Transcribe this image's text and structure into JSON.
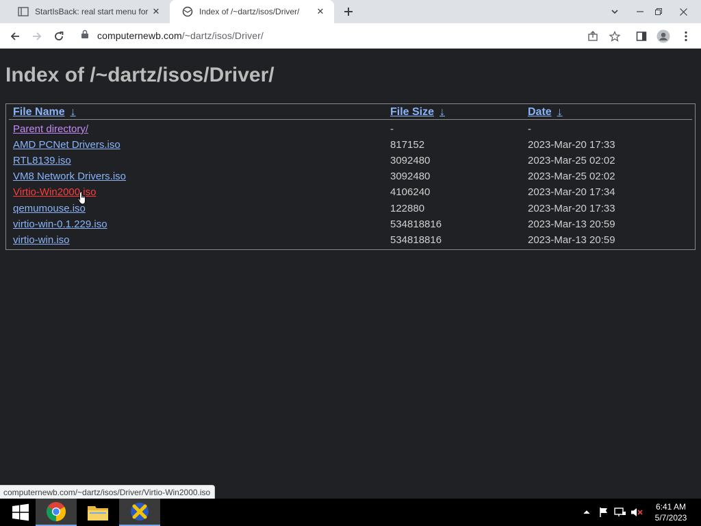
{
  "browser": {
    "tabs": [
      {
        "title": "StartIsBack: real start menu for W",
        "close": "✕",
        "active": false
      },
      {
        "title": "Index of /~dartz/isos/Driver/",
        "close": "✕",
        "active": true
      }
    ],
    "url_host": "computernewb.com",
    "url_path": "/~dartz/isos/Driver/",
    "status_url": "computernewb.com/~dartz/isos/Driver/Virtio-Win2000.iso"
  },
  "page": {
    "title": "Index of /~dartz/isos/Driver/",
    "columns": {
      "name": "File Name",
      "size": "File Size",
      "date": "Date",
      "sort_arrow": "↓"
    },
    "rows": [
      {
        "name": "Parent directory/",
        "size": "-",
        "date": "-",
        "state": "visited"
      },
      {
        "name": "AMD PCNet Drivers.iso",
        "size": "817152",
        "date": "2023-Mar-20 17:33",
        "state": "link"
      },
      {
        "name": "RTL8139.iso",
        "size": "3092480",
        "date": "2023-Mar-25 02:02",
        "state": "link"
      },
      {
        "name": "VM8 Network Drivers.iso",
        "size": "3092480",
        "date": "2023-Mar-25 02:02",
        "state": "link"
      },
      {
        "name": "Virtio-Win2000.iso",
        "size": "4106240",
        "date": "2023-Mar-20 17:34",
        "state": "hover"
      },
      {
        "name": "qemumouse.iso",
        "size": "122880",
        "date": "2023-Mar-20 17:33",
        "state": "link"
      },
      {
        "name": "virtio-win-0.1.229.iso",
        "size": "534818816",
        "date": "2023-Mar-13 20:59",
        "state": "link"
      },
      {
        "name": "virtio-win.iso",
        "size": "534818816",
        "date": "2023-Mar-13 20:59",
        "state": "link"
      }
    ]
  },
  "taskbar": {
    "time": "6:41 AM",
    "date": "5/7/2023",
    "apps": [
      "start-icon",
      "chrome-icon",
      "file-explorer-icon",
      "vm-tool-icon"
    ]
  },
  "colors": {
    "page_bg": "#202124",
    "link": "#8ab4f8",
    "visited": "#c58af9",
    "hover": "#ff3b3b"
  }
}
